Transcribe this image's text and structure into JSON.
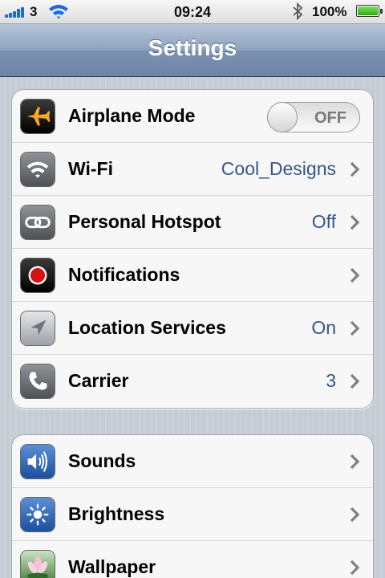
{
  "status_bar": {
    "carrier": "3",
    "time": "09:24",
    "battery": "100%",
    "signal_bars": 5,
    "battery_level": 1.0
  },
  "nav": {
    "title": "Settings"
  },
  "groups": [
    {
      "rows": [
        {
          "label": "Airplane Mode",
          "icon": "airplane-icon",
          "control": "toggle",
          "toggle_text": "OFF"
        },
        {
          "label": "Wi-Fi",
          "icon": "wifi-icon",
          "value": "Cool_Designs"
        },
        {
          "label": "Personal Hotspot",
          "icon": "hotspot-icon",
          "value": "Off"
        },
        {
          "label": "Notifications",
          "icon": "notifications-icon",
          "value": ""
        },
        {
          "label": "Location Services",
          "icon": "location-icon",
          "value": "On"
        },
        {
          "label": "Carrier",
          "icon": "phone-icon",
          "value": "3"
        }
      ]
    },
    {
      "rows": [
        {
          "label": "Sounds",
          "icon": "speaker-icon",
          "value": ""
        },
        {
          "label": "Brightness",
          "icon": "brightness-icon",
          "value": ""
        },
        {
          "label": "Wallpaper",
          "icon": "flower-icon",
          "value": ""
        }
      ]
    }
  ],
  "colors": {
    "value_text": "#385487",
    "nav_bar": "#7b92b2",
    "background": "#c5ccd4"
  }
}
